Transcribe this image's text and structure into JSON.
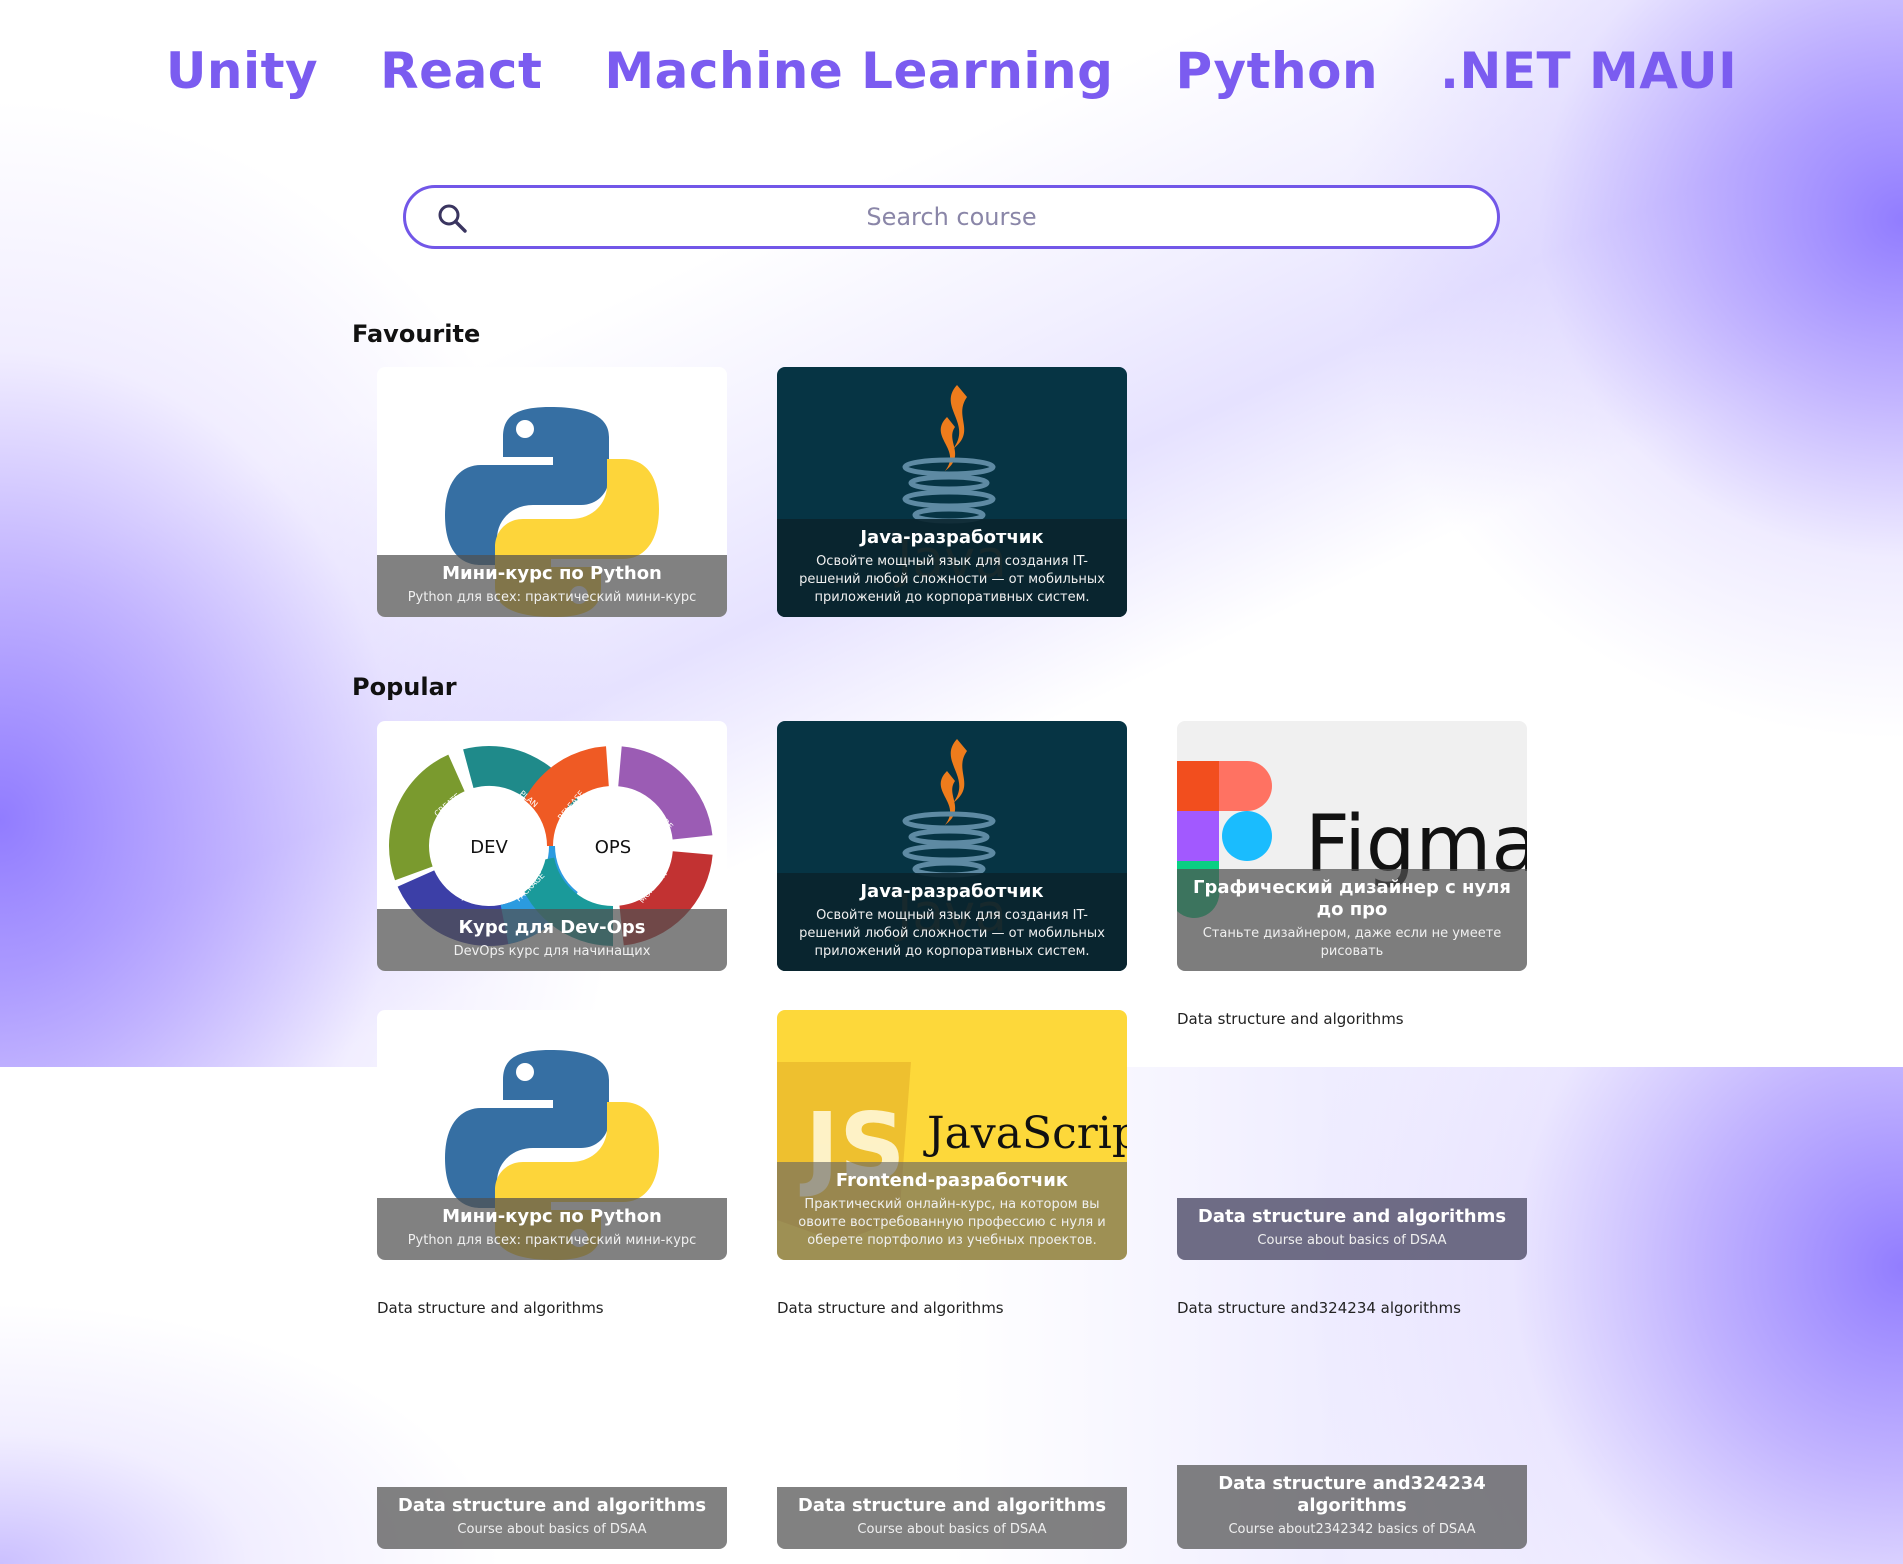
{
  "nav": [
    "Unity",
    "React",
    "Machine Learning",
    "Python",
    ".NET MAUI"
  ],
  "search": {
    "placeholder": "Search course",
    "icon": "search-icon"
  },
  "sections": {
    "favourite": "Favourite",
    "popular": "Popular"
  },
  "favourite": [
    {
      "title": "Мини-курс по Python",
      "desc": "Python для всех: практический мини-курс",
      "image": "python-logo"
    },
    {
      "title": "Java-разработчик",
      "desc": "Освойте мощный язык для создания IT-решений любой сложности — от мобильных приложений до корпоративных систем.",
      "image": "java-logo"
    }
  ],
  "popular": [
    {
      "title": "Курс для Dev-Ops",
      "desc": "DevOps курс для начинащих",
      "image": "devops-cycle",
      "devops_labels": [
        "DEV",
        "OPS",
        "CREATE",
        "PLAN",
        "RELEASE",
        "CONFIGURE",
        "VERIFY",
        "PACKAGE",
        "MONITOR"
      ]
    },
    {
      "title": "Java-разработчик",
      "desc": "Освойте мощный язык для создания IT-решений любой сложности — от мобильных приложений до корпоративных систем.",
      "image": "java-logo"
    },
    {
      "title": "Графический дизайнер с нуля до про",
      "desc": "Станьте дизайнером, даже если не умеете рисовать",
      "image": "figma-logo",
      "logo_text": "Figma"
    },
    {
      "title": "Мини-курс по Python",
      "desc": "Python для всех: практический мини-курс",
      "image": "python-logo"
    },
    {
      "title": "Frontend-разработчик",
      "desc": "Практический онлайн-курс, на котором вы овоите востребованную профессию с нуля и оберете портфолио из учебных проектов.",
      "image": "javascript-logo",
      "logo_text": "JavaScript"
    },
    {
      "title": "Data structure and algorithms",
      "desc": "Course about basics of DSAA",
      "alt": "Data structure and algorithms"
    },
    {
      "title": "Data structure and algorithms",
      "desc": "Course about basics of DSAA",
      "alt": "Data structure and algorithms"
    },
    {
      "title": "Data structure and algorithms",
      "desc": "Course about basics of DSAA",
      "alt": "Data structure and algorithms"
    },
    {
      "title": "Data structure and324234 algorithms",
      "desc": "Course about2342342 basics of DSAA",
      "alt": "Data structure and324234 algorithms"
    }
  ],
  "colors": {
    "accent": "#7b5cf0",
    "search_border": "#7257e8",
    "java_bg": "#063444",
    "js_bg": "#fdd83a"
  }
}
